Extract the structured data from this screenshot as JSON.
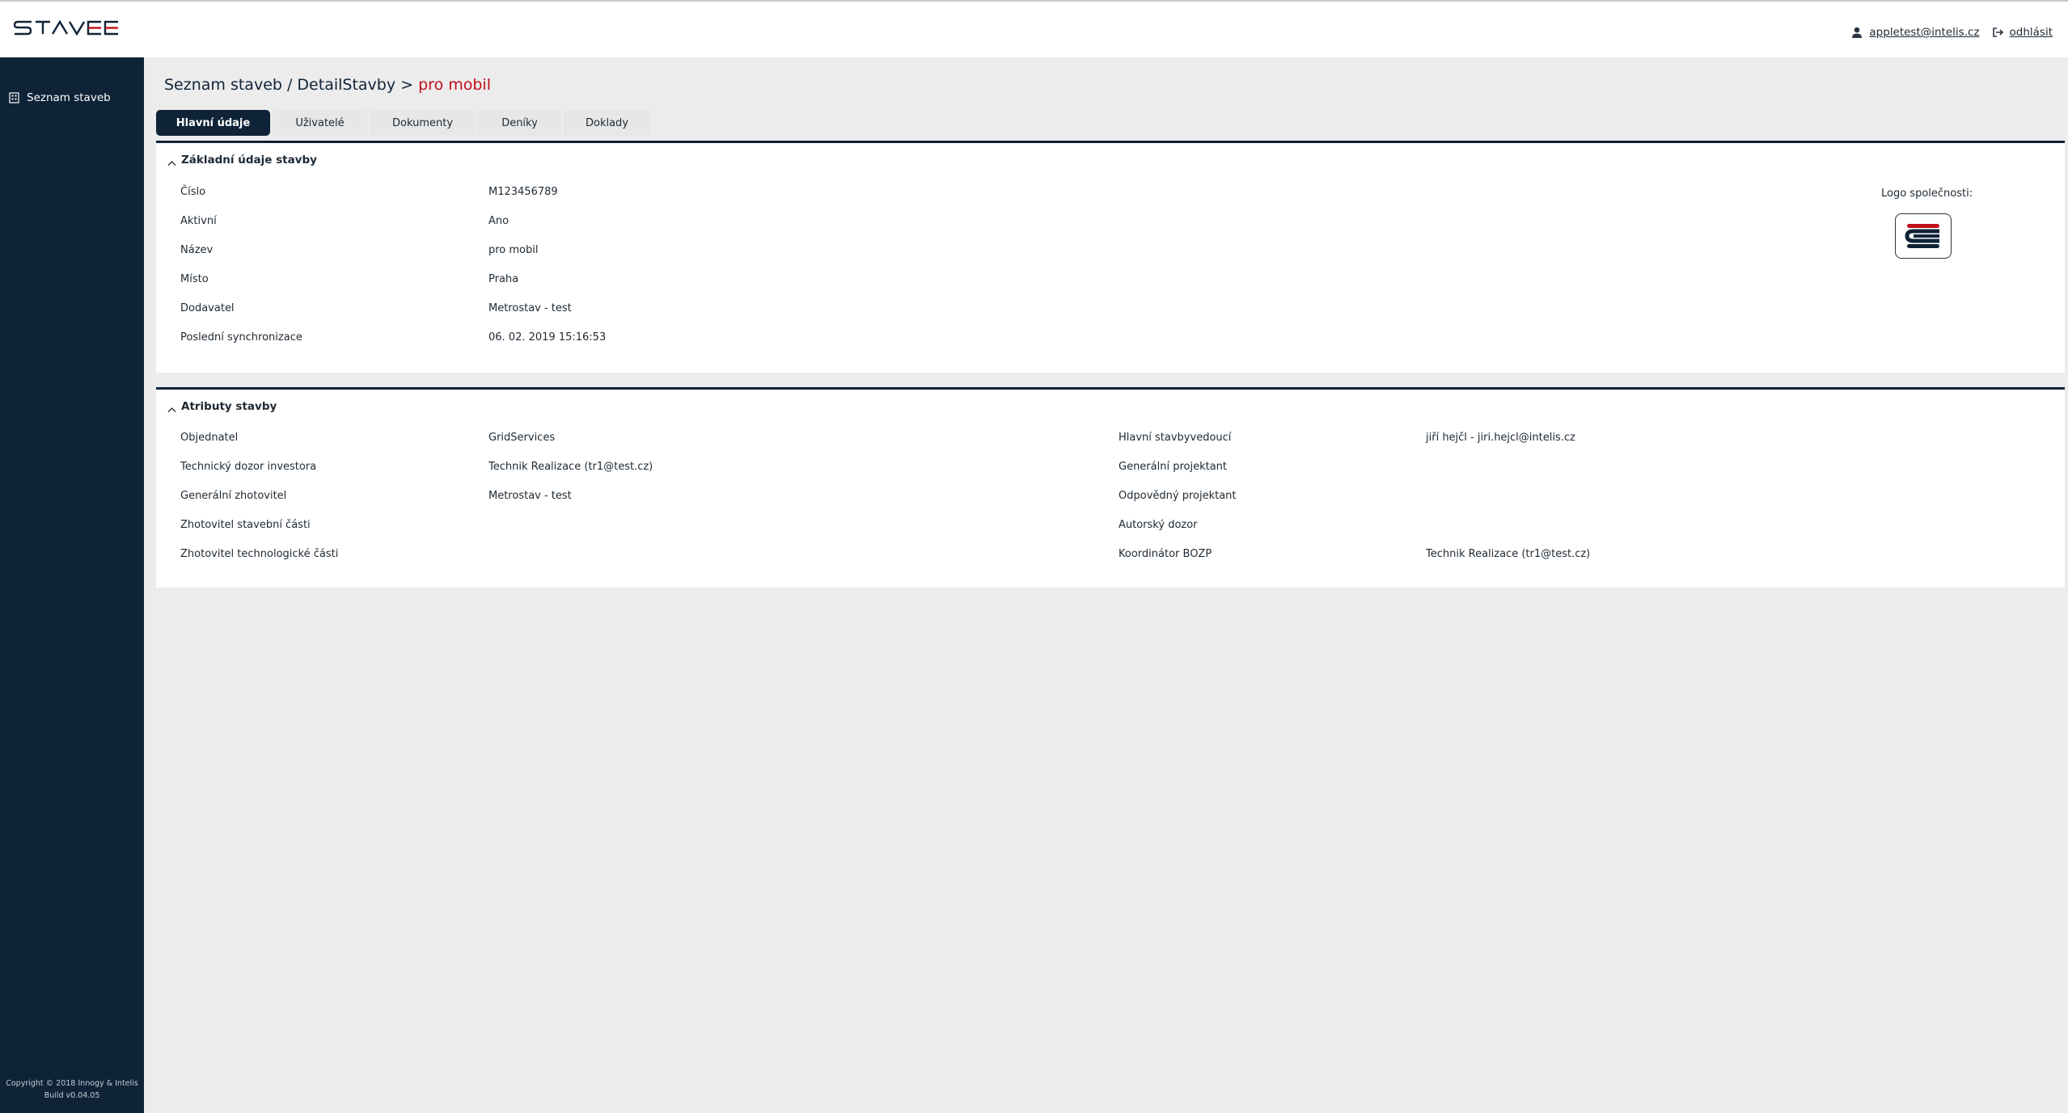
{
  "header": {
    "brand": "STAVEE",
    "user_email": "appletest@intelis.cz",
    "logout_label": "odhlásit"
  },
  "sidebar": {
    "items": [
      {
        "label": "Seznam staveb",
        "icon": "building-icon"
      }
    ],
    "copyright": "Copyright © 2018 Innogy & Intelis",
    "build": "Build v0.04.05"
  },
  "breadcrumb": {
    "path": "Seznam staveb / DetailStavby >",
    "current": "pro mobil"
  },
  "tabs": [
    {
      "label": "Hlavní údaje",
      "active": true
    },
    {
      "label": "Uživatelé",
      "active": false
    },
    {
      "label": "Dokumenty",
      "active": false
    },
    {
      "label": "Deníky",
      "active": false
    },
    {
      "label": "Doklady",
      "active": false
    }
  ],
  "basic": {
    "title": "Základní údaje stavby",
    "rows": [
      {
        "label": "Číslo",
        "value": "M123456789"
      },
      {
        "label": "Aktivní",
        "value": "Ano"
      },
      {
        "label": "Název",
        "value": "pro mobil"
      },
      {
        "label": "Místo",
        "value": "Praha"
      },
      {
        "label": "Dodavatel",
        "value": "Metrostav - test"
      },
      {
        "label": "Poslední synchronizace",
        "value": "06. 02. 2019 15:16:53"
      }
    ],
    "logo_label": "Logo společnosti:"
  },
  "attributes": {
    "title": "Atributy stavby",
    "left": [
      {
        "label": "Objednatel",
        "value": "GridServices"
      },
      {
        "label": "Technický dozor investora",
        "value": "Technik Realizace (tr1@test.cz)"
      },
      {
        "label": "Generální zhotovitel",
        "value": "Metrostav - test"
      },
      {
        "label": "Zhotovitel stavební části",
        "value": ""
      },
      {
        "label": "Zhotovitel technologické části",
        "value": ""
      }
    ],
    "right": [
      {
        "label": "Hlavní stavbyvedoucí",
        "value": "jiří hejčl - jiri.hejcl@intelis.cz"
      },
      {
        "label": "Generální projektant",
        "value": ""
      },
      {
        "label": "Odpovědný projektant",
        "value": ""
      },
      {
        "label": "Autorský dozor",
        "value": ""
      },
      {
        "label": "Koordinátor BOZP",
        "value": "Technik Realizace (tr1@test.cz)"
      }
    ]
  },
  "colors": {
    "navy": "#0f2338",
    "accent_red": "#c20e1a",
    "background": "#ececec"
  }
}
